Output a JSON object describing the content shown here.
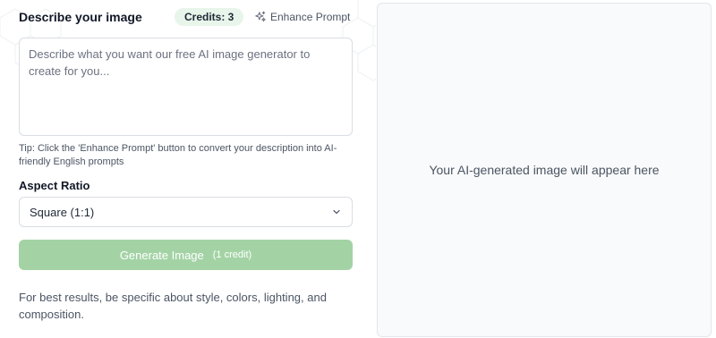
{
  "prompt_section": {
    "title": "Describe your image",
    "credits_badge": "Credits: 3",
    "enhance_button": "Enhance Prompt",
    "placeholder": "Describe what you want our free AI image generator to create for you...",
    "value": ""
  },
  "tip": "Tip: Click the 'Enhance Prompt' button to convert your description into AI-friendly English prompts",
  "aspect_ratio": {
    "label": "Aspect Ratio",
    "selected": "Square (1:1)"
  },
  "generate": {
    "label": "Generate Image",
    "credit_note": "(1 credit)",
    "color": "#a3d3a5"
  },
  "hint": "For best results, be specific about style, colors, lighting, and composition.",
  "preview": {
    "placeholder": "Your AI-generated image will appear here"
  },
  "icons": {
    "enhance": "sparkles-icon",
    "select": "chevron-down-icon"
  }
}
